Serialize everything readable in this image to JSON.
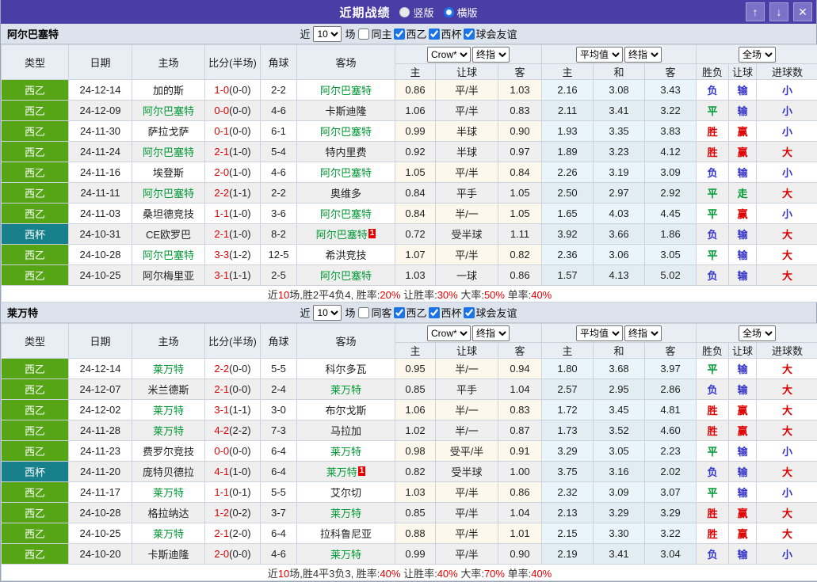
{
  "titlebar": {
    "title": "近期战绩",
    "radio_options": [
      {
        "label": "竖版",
        "selected": false
      },
      {
        "label": "横版",
        "selected": true
      }
    ],
    "buttons": {
      "up": "↑",
      "down": "↓",
      "close": "✕"
    }
  },
  "controls": {
    "near_label": "近",
    "match_count": "10",
    "games_label": "场"
  },
  "table_headers": {
    "left": [
      "类型",
      "日期",
      "主场",
      "比分(半场)",
      "角球",
      "客场"
    ],
    "selects": [
      "Crow*",
      "终指",
      "平均值",
      "终指",
      "全场"
    ],
    "sub": [
      "主",
      "让球",
      "客",
      "主",
      "和",
      "客",
      "胜负",
      "让球",
      "进球数"
    ]
  },
  "colors": {
    "titlebar_bg": "#4a3da5",
    "league_bg": "#55a517",
    "cup_bg": "#17808a",
    "focus_team": "#009933",
    "score_red": "#dd0000",
    "summary_red": "#e60000",
    "result_map": {
      "胜": "#dd0000",
      "赢": "#dd0000",
      "大": "#dd0000",
      "平": "#009933",
      "走": "#009933",
      "负": "#3333cc",
      "输": "#3333cc",
      "小": "#3333cc"
    }
  },
  "sections": [
    {
      "team": "阿尔巴塞特",
      "filter_checkboxes": [
        {
          "label": "同主",
          "checked": false
        },
        {
          "label": "西乙",
          "checked": true
        },
        {
          "label": "西杯",
          "checked": true
        },
        {
          "label": "球会友谊",
          "checked": true
        }
      ],
      "rows": [
        {
          "type": "西乙",
          "cup": false,
          "date": "24-12-14",
          "home": "加的斯",
          "home_focus": false,
          "score": "1-0",
          "half": "(0-0)",
          "corner": "2-2",
          "away": "阿尔巴塞特",
          "away_focus": true,
          "odds": [
            "0.86",
            "平/半",
            "1.03"
          ],
          "avg": [
            "2.16",
            "3.08",
            "3.43"
          ],
          "res": [
            "负",
            "输",
            "小"
          ]
        },
        {
          "type": "西乙",
          "cup": false,
          "date": "24-12-09",
          "home": "阿尔巴塞特",
          "home_focus": true,
          "score": "0-0",
          "half": "(0-0)",
          "corner": "4-6",
          "away": "卡斯迪隆",
          "away_focus": false,
          "odds": [
            "1.06",
            "平/半",
            "0.83"
          ],
          "avg": [
            "2.11",
            "3.41",
            "3.22"
          ],
          "res": [
            "平",
            "输",
            "小"
          ]
        },
        {
          "type": "西乙",
          "cup": false,
          "date": "24-11-30",
          "home": "萨拉戈萨",
          "home_focus": false,
          "score": "0-1",
          "half": "(0-0)",
          "corner": "6-1",
          "away": "阿尔巴塞特",
          "away_focus": true,
          "odds": [
            "0.99",
            "半球",
            "0.90"
          ],
          "avg": [
            "1.93",
            "3.35",
            "3.83"
          ],
          "res": [
            "胜",
            "赢",
            "小"
          ]
        },
        {
          "type": "西乙",
          "cup": false,
          "date": "24-11-24",
          "home": "阿尔巴塞特",
          "home_focus": true,
          "score": "2-1",
          "half": "(1-0)",
          "corner": "5-4",
          "away": "特内里费",
          "away_focus": false,
          "odds": [
            "0.92",
            "半球",
            "0.97"
          ],
          "avg": [
            "1.89",
            "3.23",
            "4.12"
          ],
          "res": [
            "胜",
            "赢",
            "大"
          ]
        },
        {
          "type": "西乙",
          "cup": false,
          "date": "24-11-16",
          "home": "埃登斯",
          "home_focus": false,
          "score": "2-0",
          "half": "(1-0)",
          "corner": "4-6",
          "away": "阿尔巴塞特",
          "away_focus": true,
          "odds": [
            "1.05",
            "平/半",
            "0.84"
          ],
          "avg": [
            "2.26",
            "3.19",
            "3.09"
          ],
          "res": [
            "负",
            "输",
            "小"
          ]
        },
        {
          "type": "西乙",
          "cup": false,
          "date": "24-11-11",
          "home": "阿尔巴塞特",
          "home_focus": true,
          "score": "2-2",
          "half": "(1-1)",
          "corner": "2-2",
          "away": "奥维多",
          "away_focus": false,
          "odds": [
            "0.84",
            "平手",
            "1.05"
          ],
          "avg": [
            "2.50",
            "2.97",
            "2.92"
          ],
          "res": [
            "平",
            "走",
            "大"
          ]
        },
        {
          "type": "西乙",
          "cup": false,
          "date": "24-11-03",
          "home": "桑坦德竞技",
          "home_focus": false,
          "score": "1-1",
          "half": "(1-0)",
          "corner": "3-6",
          "away": "阿尔巴塞特",
          "away_focus": true,
          "odds": [
            "0.84",
            "半/一",
            "1.05"
          ],
          "avg": [
            "1.65",
            "4.03",
            "4.45"
          ],
          "res": [
            "平",
            "赢",
            "小"
          ]
        },
        {
          "type": "西杯",
          "cup": true,
          "date": "24-10-31",
          "home": "CE欧罗巴",
          "home_focus": false,
          "score": "2-1",
          "half": "(1-0)",
          "corner": "8-2",
          "away": "阿尔巴塞特",
          "away_focus": true,
          "away_badge": "1",
          "odds": [
            "0.72",
            "受半球",
            "1.11"
          ],
          "avg": [
            "3.92",
            "3.66",
            "1.86"
          ],
          "res": [
            "负",
            "输",
            "大"
          ]
        },
        {
          "type": "西乙",
          "cup": false,
          "date": "24-10-28",
          "home": "阿尔巴塞特",
          "home_focus": true,
          "score": "3-3",
          "half": "(1-2)",
          "corner": "12-5",
          "away": "希洪竞技",
          "away_focus": false,
          "odds": [
            "1.07",
            "平/半",
            "0.82"
          ],
          "avg": [
            "2.36",
            "3.06",
            "3.05"
          ],
          "res": [
            "平",
            "输",
            "大"
          ]
        },
        {
          "type": "西乙",
          "cup": false,
          "date": "24-10-25",
          "home": "阿尔梅里亚",
          "home_focus": false,
          "score": "3-1",
          "half": "(1-1)",
          "corner": "2-5",
          "away": "阿尔巴塞特",
          "away_focus": true,
          "odds": [
            "1.03",
            "一球",
            "0.86"
          ],
          "avg": [
            "1.57",
            "4.13",
            "5.02"
          ],
          "res": [
            "负",
            "输",
            "大"
          ]
        }
      ],
      "summary_parts": [
        {
          "text": "近",
          "red": false
        },
        {
          "text": "10",
          "red": true
        },
        {
          "text": "场,胜2平4负4, 胜率:",
          "red": false
        },
        {
          "text": "20%",
          "red": true
        },
        {
          "text": " 让胜率:",
          "red": false
        },
        {
          "text": "30%",
          "red": true
        },
        {
          "text": " 大率:",
          "red": false
        },
        {
          "text": "50%",
          "red": true
        },
        {
          "text": " 单率:",
          "red": false
        },
        {
          "text": "40%",
          "red": true
        }
      ]
    },
    {
      "team": "莱万特",
      "filter_checkboxes": [
        {
          "label": "同客",
          "checked": false
        },
        {
          "label": "西乙",
          "checked": true
        },
        {
          "label": "西杯",
          "checked": true
        },
        {
          "label": "球会友谊",
          "checked": true
        }
      ],
      "rows": [
        {
          "type": "西乙",
          "cup": false,
          "date": "24-12-14",
          "home": "莱万特",
          "home_focus": true,
          "score": "2-2",
          "half": "(0-0)",
          "corner": "5-5",
          "away": "科尔多瓦",
          "away_focus": false,
          "odds": [
            "0.95",
            "半/一",
            "0.94"
          ],
          "avg": [
            "1.80",
            "3.68",
            "3.97"
          ],
          "res": [
            "平",
            "输",
            "大"
          ]
        },
        {
          "type": "西乙",
          "cup": false,
          "date": "24-12-07",
          "home": "米兰德斯",
          "home_focus": false,
          "score": "2-1",
          "half": "(0-0)",
          "corner": "2-4",
          "away": "莱万特",
          "away_focus": true,
          "odds": [
            "0.85",
            "平手",
            "1.04"
          ],
          "avg": [
            "2.57",
            "2.95",
            "2.86"
          ],
          "res": [
            "负",
            "输",
            "大"
          ]
        },
        {
          "type": "西乙",
          "cup": false,
          "date": "24-12-02",
          "home": "莱万特",
          "home_focus": true,
          "score": "3-1",
          "half": "(1-1)",
          "corner": "3-0",
          "away": "布尔戈斯",
          "away_focus": false,
          "odds": [
            "1.06",
            "半/一",
            "0.83"
          ],
          "avg": [
            "1.72",
            "3.45",
            "4.81"
          ],
          "res": [
            "胜",
            "赢",
            "大"
          ]
        },
        {
          "type": "西乙",
          "cup": false,
          "date": "24-11-28",
          "home": "莱万特",
          "home_focus": true,
          "score": "4-2",
          "half": "(2-2)",
          "corner": "7-3",
          "away": "马拉加",
          "away_focus": false,
          "odds": [
            "1.02",
            "半/一",
            "0.87"
          ],
          "avg": [
            "1.73",
            "3.52",
            "4.60"
          ],
          "res": [
            "胜",
            "赢",
            "大"
          ]
        },
        {
          "type": "西乙",
          "cup": false,
          "date": "24-11-23",
          "home": "费罗尔竞技",
          "home_focus": false,
          "score": "0-0",
          "half": "(0-0)",
          "corner": "6-4",
          "away": "莱万特",
          "away_focus": true,
          "odds": [
            "0.98",
            "受平/半",
            "0.91"
          ],
          "avg": [
            "3.29",
            "3.05",
            "2.23"
          ],
          "res": [
            "平",
            "输",
            "小"
          ]
        },
        {
          "type": "西杯",
          "cup": true,
          "date": "24-11-20",
          "home": "庞特贝德拉",
          "home_focus": false,
          "score": "4-1",
          "half": "(1-0)",
          "corner": "6-4",
          "away": "莱万特",
          "away_focus": true,
          "away_badge": "1",
          "odds": [
            "0.82",
            "受半球",
            "1.00"
          ],
          "avg": [
            "3.75",
            "3.16",
            "2.02"
          ],
          "res": [
            "负",
            "输",
            "大"
          ]
        },
        {
          "type": "西乙",
          "cup": false,
          "date": "24-11-17",
          "home": "莱万特",
          "home_focus": true,
          "score": "1-1",
          "half": "(0-1)",
          "corner": "5-5",
          "away": "艾尔切",
          "away_focus": false,
          "odds": [
            "1.03",
            "平/半",
            "0.86"
          ],
          "avg": [
            "2.32",
            "3.09",
            "3.07"
          ],
          "res": [
            "平",
            "输",
            "小"
          ]
        },
        {
          "type": "西乙",
          "cup": false,
          "date": "24-10-28",
          "home": "格拉纳达",
          "home_focus": false,
          "score": "1-2",
          "half": "(0-2)",
          "corner": "3-7",
          "away": "莱万特",
          "away_focus": true,
          "odds": [
            "0.85",
            "平/半",
            "1.04"
          ],
          "avg": [
            "2.13",
            "3.29",
            "3.29"
          ],
          "res": [
            "胜",
            "赢",
            "大"
          ]
        },
        {
          "type": "西乙",
          "cup": false,
          "date": "24-10-25",
          "home": "莱万特",
          "home_focus": true,
          "score": "2-1",
          "half": "(2-0)",
          "corner": "6-4",
          "away": "拉科鲁尼亚",
          "away_focus": false,
          "odds": [
            "0.88",
            "平/半",
            "1.01"
          ],
          "avg": [
            "2.15",
            "3.30",
            "3.22"
          ],
          "res": [
            "胜",
            "赢",
            "大"
          ]
        },
        {
          "type": "西乙",
          "cup": false,
          "date": "24-10-20",
          "home": "卡斯迪隆",
          "home_focus": false,
          "score": "2-0",
          "half": "(0-0)",
          "corner": "4-6",
          "away": "莱万特",
          "away_focus": true,
          "odds": [
            "0.99",
            "平/半",
            "0.90"
          ],
          "avg": [
            "2.19",
            "3.41",
            "3.04"
          ],
          "res": [
            "负",
            "输",
            "小"
          ]
        }
      ],
      "summary_parts": [
        {
          "text": "近",
          "red": false
        },
        {
          "text": "10",
          "red": true
        },
        {
          "text": "场,胜4平3负3, 胜率:",
          "red": false
        },
        {
          "text": "40%",
          "red": true
        },
        {
          "text": " 让胜率:",
          "red": false
        },
        {
          "text": "40%",
          "red": true
        },
        {
          "text": " 大率:",
          "red": false
        },
        {
          "text": "70%",
          "red": true
        },
        {
          "text": " 单率:",
          "red": false
        },
        {
          "text": "40%",
          "red": true
        }
      ]
    }
  ]
}
